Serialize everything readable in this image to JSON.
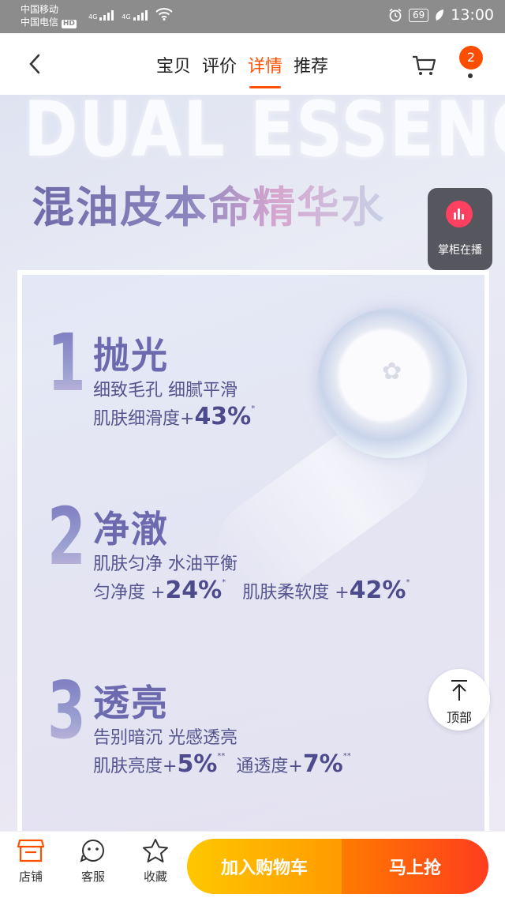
{
  "status_bar": {
    "carrier_1": "中国移动",
    "carrier_2": "中国电信",
    "hd": "HD",
    "network_1": "4G",
    "network_2": "4G",
    "battery": "69",
    "time": "13:00"
  },
  "header": {
    "tabs": [
      {
        "label": "宝贝",
        "active": false
      },
      {
        "label": "评价",
        "active": false
      },
      {
        "label": "详情",
        "active": true
      },
      {
        "label": "推荐",
        "active": false
      }
    ],
    "badge_count": "2",
    "accent_color": "#ff5000"
  },
  "poster": {
    "hero_en": "DUAL ESSENCE",
    "hero_cn": "混油皮本命精华水",
    "features": [
      {
        "number": "1",
        "title": "抛光",
        "line1": "细致毛孔 细腻平滑",
        "line2_prefix": "肌肤细滑度+",
        "line2_value": "43%",
        "line2_mark": "*"
      },
      {
        "number": "2",
        "title": "净澈",
        "line1": "肌肤匀净 水油平衡",
        "line2_prefix": "匀净度 +",
        "line2_value": "24%",
        "line2_mark": "*",
        "line2b_prefix": "肌肤柔软度 +",
        "line2b_value": "42%",
        "line2b_mark": "*"
      },
      {
        "number": "3",
        "title": "透亮",
        "line1": "告别暗沉 光感透亮",
        "line2_prefix": "肌肤亮度+",
        "line2_value": "5%",
        "line2_mark": "**",
        "line2b_prefix": "通透度+",
        "line2b_value": "7%",
        "line2b_mark": "**"
      }
    ]
  },
  "floating": {
    "live_label": "掌柜在播",
    "top_label": "顶部"
  },
  "bottom_bar": {
    "shop": "店铺",
    "service": "客服",
    "favorite": "收藏",
    "add_to_cart": "加入购物车",
    "buy_now": "马上抢",
    "cart_color": "#ffb300",
    "buy_color": "#ff4d00"
  }
}
